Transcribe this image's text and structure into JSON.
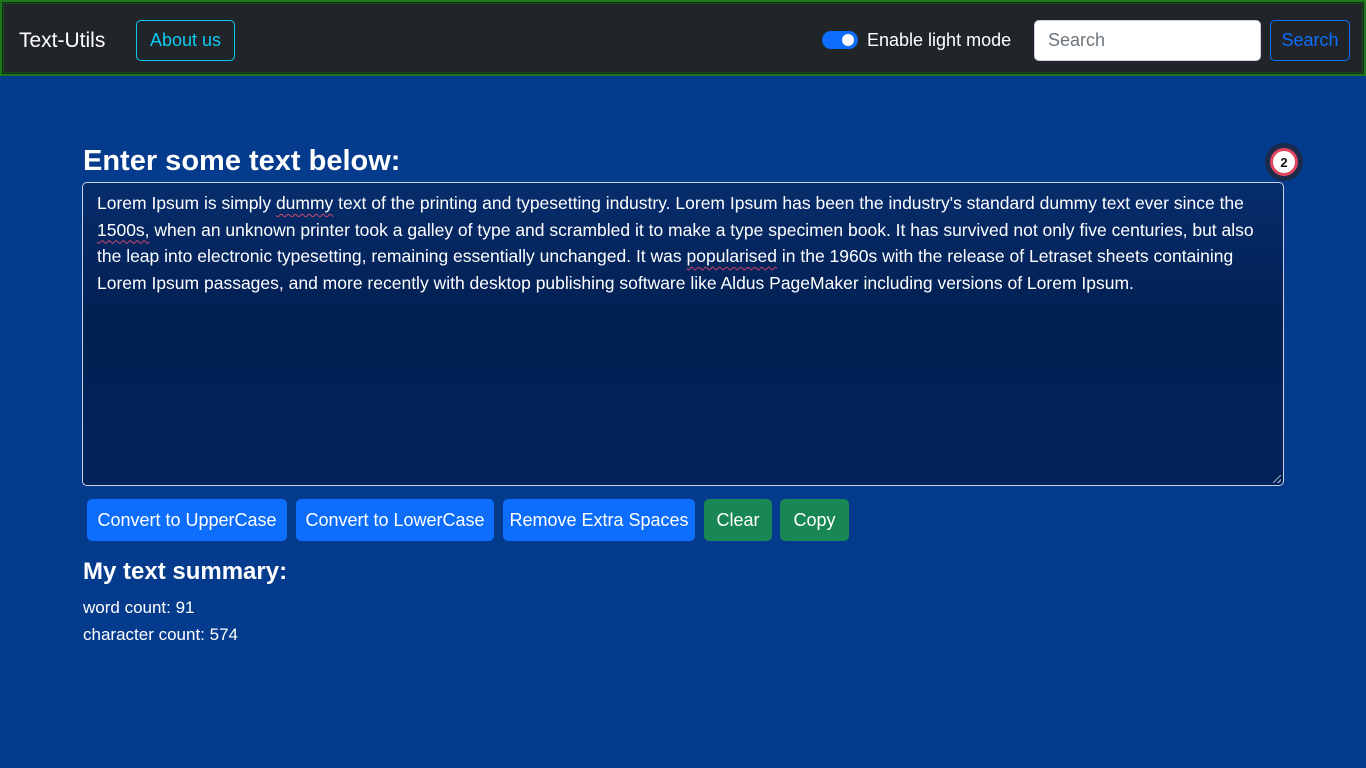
{
  "navbar": {
    "brand": "Text-Utils",
    "about_label": "About us",
    "toggle_label": "Enable light mode",
    "toggle_on": true,
    "search_placeholder": "Search",
    "search_button": "Search"
  },
  "main": {
    "heading": "Enter some text below:",
    "badge_count": "2",
    "textarea": {
      "segments": [
        "Lorem Ipsum is simply ",
        "dummy",
        " text of the printing and typesetting industry. Lorem Ipsum has been the industry's standard dummy text ever since the ",
        "1500s,",
        " when an unknown printer took a galley of type and scrambled it to make a type specimen book. It has survived not only five centuries, but also the leap into electronic typesetting, remaining essentially unchanged. It was ",
        "popularised",
        " in the 1960s with the release of Letraset sheets containing Lorem Ipsum passages, and more recently with desktop publishing software like Aldus PageMaker including versions of Lorem Ipsum."
      ]
    },
    "buttons": {
      "uppercase": "Convert to UpperCase",
      "lowercase": "Convert to LowerCase",
      "remove_spaces": "Remove Extra Spaces",
      "clear": "Clear",
      "copy": "Copy"
    },
    "summary": {
      "title": "My text summary:",
      "word_count": "word count: 91",
      "char_count": "character count: 574"
    }
  },
  "colors": {
    "background": "#043b8c",
    "navbar": "#212529",
    "primary": "#0d6efd",
    "success": "#198754",
    "info": "#0dcaf0"
  }
}
